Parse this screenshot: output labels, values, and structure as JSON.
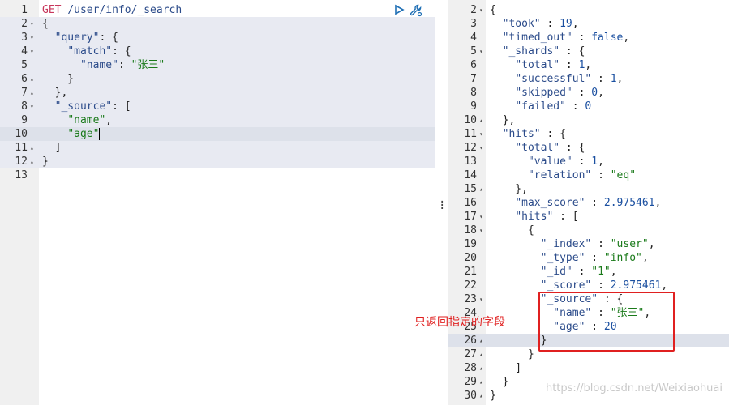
{
  "request": {
    "method": "GET",
    "path": "/user/info/_search",
    "lines": [
      {
        "n": "1",
        "fold": "",
        "cls": "",
        "tokens": [
          [
            "kw",
            "GET"
          ],
          [
            "pun",
            " "
          ],
          [
            "path",
            "/user/info/_search"
          ]
        ]
      },
      {
        "n": "2",
        "fold": "▾",
        "cls": "hl-block",
        "tokens": [
          [
            "pun",
            "{"
          ]
        ]
      },
      {
        "n": "3",
        "fold": "▾",
        "cls": "hl-block",
        "tokens": [
          [
            "pun",
            "  "
          ],
          [
            "key",
            "\"query\""
          ],
          [
            "pun",
            ": {"
          ]
        ]
      },
      {
        "n": "4",
        "fold": "▾",
        "cls": "hl-block",
        "tokens": [
          [
            "pun",
            "    "
          ],
          [
            "key",
            "\"match\""
          ],
          [
            "pun",
            ": {"
          ]
        ]
      },
      {
        "n": "5",
        "fold": "",
        "cls": "hl-block",
        "tokens": [
          [
            "pun",
            "      "
          ],
          [
            "key",
            "\"name\""
          ],
          [
            "pun",
            ": "
          ],
          [
            "str",
            "\"张三\""
          ]
        ]
      },
      {
        "n": "6",
        "fold": "▴",
        "cls": "hl-block",
        "tokens": [
          [
            "pun",
            "    }"
          ]
        ]
      },
      {
        "n": "7",
        "fold": "▴",
        "cls": "hl-block",
        "tokens": [
          [
            "pun",
            "  },"
          ]
        ]
      },
      {
        "n": "8",
        "fold": "▾",
        "cls": "hl-block",
        "tokens": [
          [
            "pun",
            "  "
          ],
          [
            "key",
            "\"_source\""
          ],
          [
            "pun",
            ": ["
          ]
        ]
      },
      {
        "n": "9",
        "fold": "",
        "cls": "hl-block",
        "tokens": [
          [
            "pun",
            "    "
          ],
          [
            "str",
            "\"name\""
          ],
          [
            "pun",
            ","
          ]
        ]
      },
      {
        "n": "10",
        "fold": "",
        "cls": "hl-active",
        "tokens": [
          [
            "pun",
            "    "
          ],
          [
            "str",
            "\"age\""
          ]
        ],
        "cursor": true
      },
      {
        "n": "11",
        "fold": "▴",
        "cls": "hl-block",
        "tokens": [
          [
            "pun",
            "  ]"
          ]
        ]
      },
      {
        "n": "12",
        "fold": "▴",
        "cls": "hl-block",
        "tokens": [
          [
            "pun",
            "}"
          ]
        ]
      },
      {
        "n": "13",
        "fold": "",
        "cls": "",
        "tokens": []
      }
    ]
  },
  "response": {
    "lines": [
      {
        "n": "2",
        "fold": "▾",
        "cls": "",
        "tokens": [
          [
            "pun",
            "{"
          ]
        ]
      },
      {
        "n": "3",
        "fold": "",
        "cls": "",
        "tokens": [
          [
            "pun",
            "  "
          ],
          [
            "key",
            "\"took\""
          ],
          [
            "pun",
            " : "
          ],
          [
            "num",
            "19"
          ],
          [
            "pun",
            ","
          ]
        ]
      },
      {
        "n": "4",
        "fold": "",
        "cls": "",
        "tokens": [
          [
            "pun",
            "  "
          ],
          [
            "key",
            "\"timed_out\""
          ],
          [
            "pun",
            " : "
          ],
          [
            "bool",
            "false"
          ],
          [
            "pun",
            ","
          ]
        ]
      },
      {
        "n": "5",
        "fold": "▾",
        "cls": "",
        "tokens": [
          [
            "pun",
            "  "
          ],
          [
            "key",
            "\"_shards\""
          ],
          [
            "pun",
            " : {"
          ]
        ]
      },
      {
        "n": "6",
        "fold": "",
        "cls": "",
        "tokens": [
          [
            "pun",
            "    "
          ],
          [
            "key",
            "\"total\""
          ],
          [
            "pun",
            " : "
          ],
          [
            "num",
            "1"
          ],
          [
            "pun",
            ","
          ]
        ]
      },
      {
        "n": "7",
        "fold": "",
        "cls": "",
        "tokens": [
          [
            "pun",
            "    "
          ],
          [
            "key",
            "\"successful\""
          ],
          [
            "pun",
            " : "
          ],
          [
            "num",
            "1"
          ],
          [
            "pun",
            ","
          ]
        ]
      },
      {
        "n": "8",
        "fold": "",
        "cls": "",
        "tokens": [
          [
            "pun",
            "    "
          ],
          [
            "key",
            "\"skipped\""
          ],
          [
            "pun",
            " : "
          ],
          [
            "num",
            "0"
          ],
          [
            "pun",
            ","
          ]
        ]
      },
      {
        "n": "9",
        "fold": "",
        "cls": "",
        "tokens": [
          [
            "pun",
            "    "
          ],
          [
            "key",
            "\"failed\""
          ],
          [
            "pun",
            " : "
          ],
          [
            "num",
            "0"
          ]
        ]
      },
      {
        "n": "10",
        "fold": "▴",
        "cls": "",
        "tokens": [
          [
            "pun",
            "  },"
          ]
        ]
      },
      {
        "n": "11",
        "fold": "▾",
        "cls": "",
        "tokens": [
          [
            "pun",
            "  "
          ],
          [
            "key",
            "\"hits\""
          ],
          [
            "pun",
            " : {"
          ]
        ]
      },
      {
        "n": "12",
        "fold": "▾",
        "cls": "",
        "tokens": [
          [
            "pun",
            "    "
          ],
          [
            "key",
            "\"total\""
          ],
          [
            "pun",
            " : {"
          ]
        ]
      },
      {
        "n": "13",
        "fold": "",
        "cls": "",
        "tokens": [
          [
            "pun",
            "      "
          ],
          [
            "key",
            "\"value\""
          ],
          [
            "pun",
            " : "
          ],
          [
            "num",
            "1"
          ],
          [
            "pun",
            ","
          ]
        ]
      },
      {
        "n": "14",
        "fold": "",
        "cls": "",
        "tokens": [
          [
            "pun",
            "      "
          ],
          [
            "key",
            "\"relation\""
          ],
          [
            "pun",
            " : "
          ],
          [
            "str",
            "\"eq\""
          ]
        ]
      },
      {
        "n": "15",
        "fold": "▴",
        "cls": "",
        "tokens": [
          [
            "pun",
            "    },"
          ]
        ]
      },
      {
        "n": "16",
        "fold": "",
        "cls": "",
        "tokens": [
          [
            "pun",
            "    "
          ],
          [
            "key",
            "\"max_score\""
          ],
          [
            "pun",
            " : "
          ],
          [
            "num",
            "2.975461"
          ],
          [
            "pun",
            ","
          ]
        ]
      },
      {
        "n": "17",
        "fold": "▾",
        "cls": "",
        "tokens": [
          [
            "pun",
            "    "
          ],
          [
            "key",
            "\"hits\""
          ],
          [
            "pun",
            " : ["
          ]
        ]
      },
      {
        "n": "18",
        "fold": "▾",
        "cls": "",
        "tokens": [
          [
            "pun",
            "      {"
          ]
        ]
      },
      {
        "n": "19",
        "fold": "",
        "cls": "",
        "tokens": [
          [
            "pun",
            "        "
          ],
          [
            "key",
            "\"_index\""
          ],
          [
            "pun",
            " : "
          ],
          [
            "str",
            "\"user\""
          ],
          [
            "pun",
            ","
          ]
        ]
      },
      {
        "n": "20",
        "fold": "",
        "cls": "",
        "tokens": [
          [
            "pun",
            "        "
          ],
          [
            "key",
            "\"_type\""
          ],
          [
            "pun",
            " : "
          ],
          [
            "str",
            "\"info\""
          ],
          [
            "pun",
            ","
          ]
        ]
      },
      {
        "n": "21",
        "fold": "",
        "cls": "",
        "tokens": [
          [
            "pun",
            "        "
          ],
          [
            "key",
            "\"_id\""
          ],
          [
            "pun",
            " : "
          ],
          [
            "str",
            "\"1\""
          ],
          [
            "pun",
            ","
          ]
        ]
      },
      {
        "n": "22",
        "fold": "",
        "cls": "",
        "tokens": [
          [
            "pun",
            "        "
          ],
          [
            "key",
            "\"_score\""
          ],
          [
            "pun",
            " : "
          ],
          [
            "num",
            "2.975461"
          ],
          [
            "pun",
            ","
          ]
        ]
      },
      {
        "n": "23",
        "fold": "▾",
        "cls": "",
        "tokens": [
          [
            "pun",
            "        "
          ],
          [
            "key",
            "\"_source\""
          ],
          [
            "pun",
            " : {"
          ]
        ]
      },
      {
        "n": "24",
        "fold": "",
        "cls": "",
        "tokens": [
          [
            "pun",
            "          "
          ],
          [
            "key",
            "\"name\""
          ],
          [
            "pun",
            " : "
          ],
          [
            "str",
            "\"张三\""
          ],
          [
            "pun",
            ","
          ]
        ]
      },
      {
        "n": "25",
        "fold": "",
        "cls": "",
        "tokens": [
          [
            "pun",
            "          "
          ],
          [
            "key",
            "\"age\""
          ],
          [
            "pun",
            " : "
          ],
          [
            "num",
            "20"
          ]
        ]
      },
      {
        "n": "26",
        "fold": "▴",
        "cls": "hl-active",
        "tokens": [
          [
            "pun",
            "        }"
          ]
        ]
      },
      {
        "n": "27",
        "fold": "▴",
        "cls": "",
        "tokens": [
          [
            "pun",
            "      }"
          ]
        ]
      },
      {
        "n": "28",
        "fold": "▴",
        "cls": "",
        "tokens": [
          [
            "pun",
            "    ]"
          ]
        ]
      },
      {
        "n": "29",
        "fold": "▴",
        "cls": "",
        "tokens": [
          [
            "pun",
            "  }"
          ]
        ]
      },
      {
        "n": "30",
        "fold": "▴",
        "cls": "",
        "tokens": [
          [
            "pun",
            "}"
          ]
        ]
      }
    ]
  },
  "toolbar": {
    "run_icon": "play-icon",
    "settings_icon": "wrench-icon"
  },
  "annotation": {
    "text": "只返回指定的字段"
  },
  "watermark": "https://blog.csdn.net/Weixiaohuai",
  "colors": {
    "keyword": "#c8375b",
    "key": "#2b4b8a",
    "string": "#1a7a1a",
    "number": "#1a4fa0",
    "annotation": "#e02020"
  }
}
